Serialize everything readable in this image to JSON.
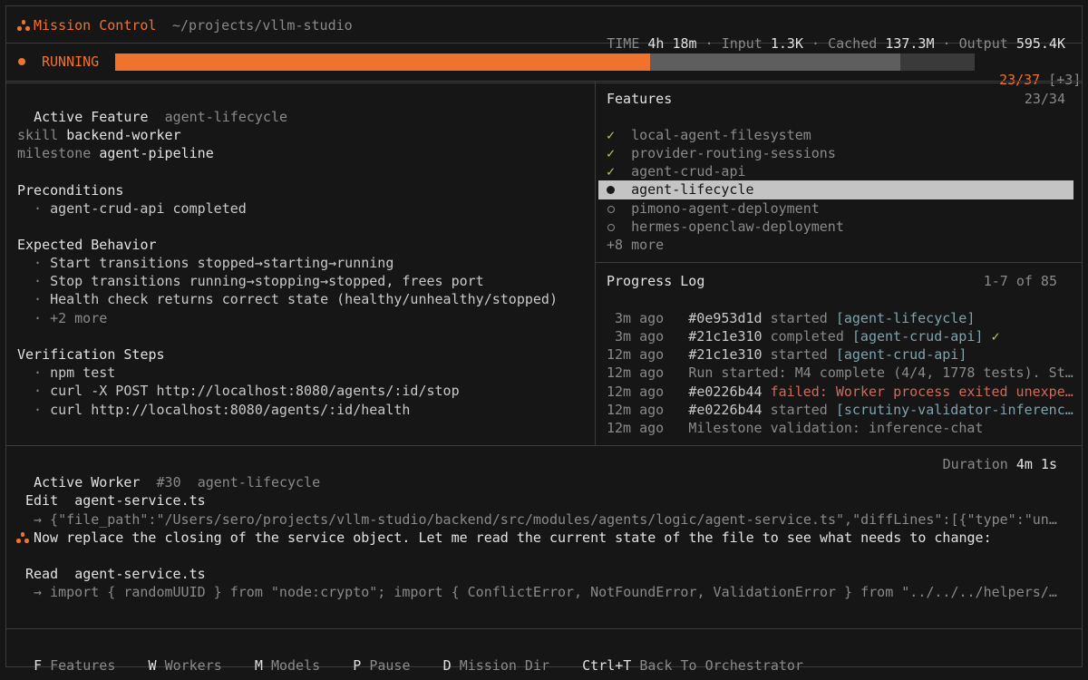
{
  "header": {
    "app_name": "Mission Control",
    "path": "~/projects/vllm-studio",
    "stats": [
      {
        "label": "TIME",
        "value": "4h 18m"
      },
      {
        "label": "Input",
        "value": "1.3K"
      },
      {
        "label": "Cached",
        "value": "137.3M"
      },
      {
        "label": "Output",
        "value": "595.4K"
      }
    ],
    "separator": "·"
  },
  "status": {
    "state": "RUNNING",
    "count": "23/37",
    "delta": "[+3]",
    "completed_fraction": 0.622,
    "pending_fraction": 0.292,
    "accent_color": "#f0732d"
  },
  "active_feature": {
    "title": "Active Feature",
    "name": "agent-lifecycle",
    "skill_label": "skill",
    "skill": "backend-worker",
    "milestone_label": "milestone",
    "milestone": "agent-pipeline",
    "preconditions_title": "Preconditions",
    "preconditions": [
      "agent-crud-api completed"
    ],
    "expected_title": "Expected Behavior",
    "expected": [
      "Start transitions stopped→starting→running",
      "Stop transitions running→stopping→stopped, frees port",
      "Health check returns correct state (healthy/unhealthy/stopped)"
    ],
    "expected_more": "+2 more",
    "verification_title": "Verification Steps",
    "verification": [
      "npm test",
      "curl -X POST http://localhost:8080/agents/:id/stop",
      "curl http://localhost:8080/agents/:id/health"
    ],
    "bullet": "·"
  },
  "features": {
    "title": "Features",
    "count": "23/34",
    "items": [
      {
        "status": "done",
        "marker": "✓",
        "name": "local-agent-filesystem"
      },
      {
        "status": "done",
        "marker": "✓",
        "name": "provider-routing-sessions"
      },
      {
        "status": "done",
        "marker": "✓",
        "name": "agent-crud-api"
      },
      {
        "status": "active",
        "marker": "●",
        "name": "agent-lifecycle"
      },
      {
        "status": "pending",
        "marker": "○",
        "name": "pimono-agent-deployment"
      },
      {
        "status": "pending",
        "marker": "○",
        "name": "hermes-openclaw-deployment"
      }
    ],
    "more": "+8 more"
  },
  "progress_log": {
    "title": "Progress Log",
    "range": "1-7 of 85",
    "entries": [
      {
        "time": "3m ago",
        "hash": "#0e953d1d",
        "text": "started",
        "tag": "[agent-lifecycle]",
        "suffix": ""
      },
      {
        "time": "3m ago",
        "hash": "#21c1e310",
        "text": "completed",
        "tag": "[agent-crud-api]",
        "suffix": "✓"
      },
      {
        "time": "12m ago",
        "hash": "#21c1e310",
        "text": "started",
        "tag": "[agent-crud-api]",
        "suffix": ""
      },
      {
        "time": "12m ago",
        "hash": "",
        "text": "Run started: M4 complete (4/4, 1778 tests). St…",
        "tag": "",
        "suffix": ""
      },
      {
        "time": "12m ago",
        "hash": "#e0226b44",
        "text": "failed: Worker process exited unexpe…",
        "tag": "",
        "suffix": ""
      },
      {
        "time": "12m ago",
        "hash": "#e0226b44",
        "text": "started",
        "tag": "[scrutiny-validator-inferenc…",
        "suffix": ""
      },
      {
        "time": "12m ago",
        "hash": "",
        "text": "Milestone validation: inference-chat",
        "tag": "",
        "suffix": ""
      }
    ]
  },
  "active_worker": {
    "title": "Active Worker",
    "id": "#30",
    "feature": "agent-lifecycle",
    "duration_label": "Duration",
    "duration": "4m 1s",
    "edit_label": "Edit",
    "edit_file": "agent-service.ts",
    "edit_detail": "→ {\"file_path\":\"/Users/sero/projects/vllm-studio/backend/src/modules/agents/logic/agent-service.ts\",\"diffLines\":[{\"type\":\"un…",
    "message": "Now replace the closing of the service object. Let me read the current state of the file to see what needs to change:",
    "read_label": "Read",
    "read_file": "agent-service.ts",
    "read_detail": "→ import { randomUUID } from \"node:crypto\"; import { ConflictError, NotFoundError, ValidationError } from \"../../../helpers/…"
  },
  "footer": {
    "shortcuts": [
      {
        "key": "F",
        "label": "Features"
      },
      {
        "key": "W",
        "label": "Workers"
      },
      {
        "key": "M",
        "label": "Models"
      },
      {
        "key": "P",
        "label": "Pause"
      },
      {
        "key": "D",
        "label": "Mission Dir"
      },
      {
        "key": "Ctrl+T",
        "label": "Back To Orchestrator"
      }
    ]
  }
}
